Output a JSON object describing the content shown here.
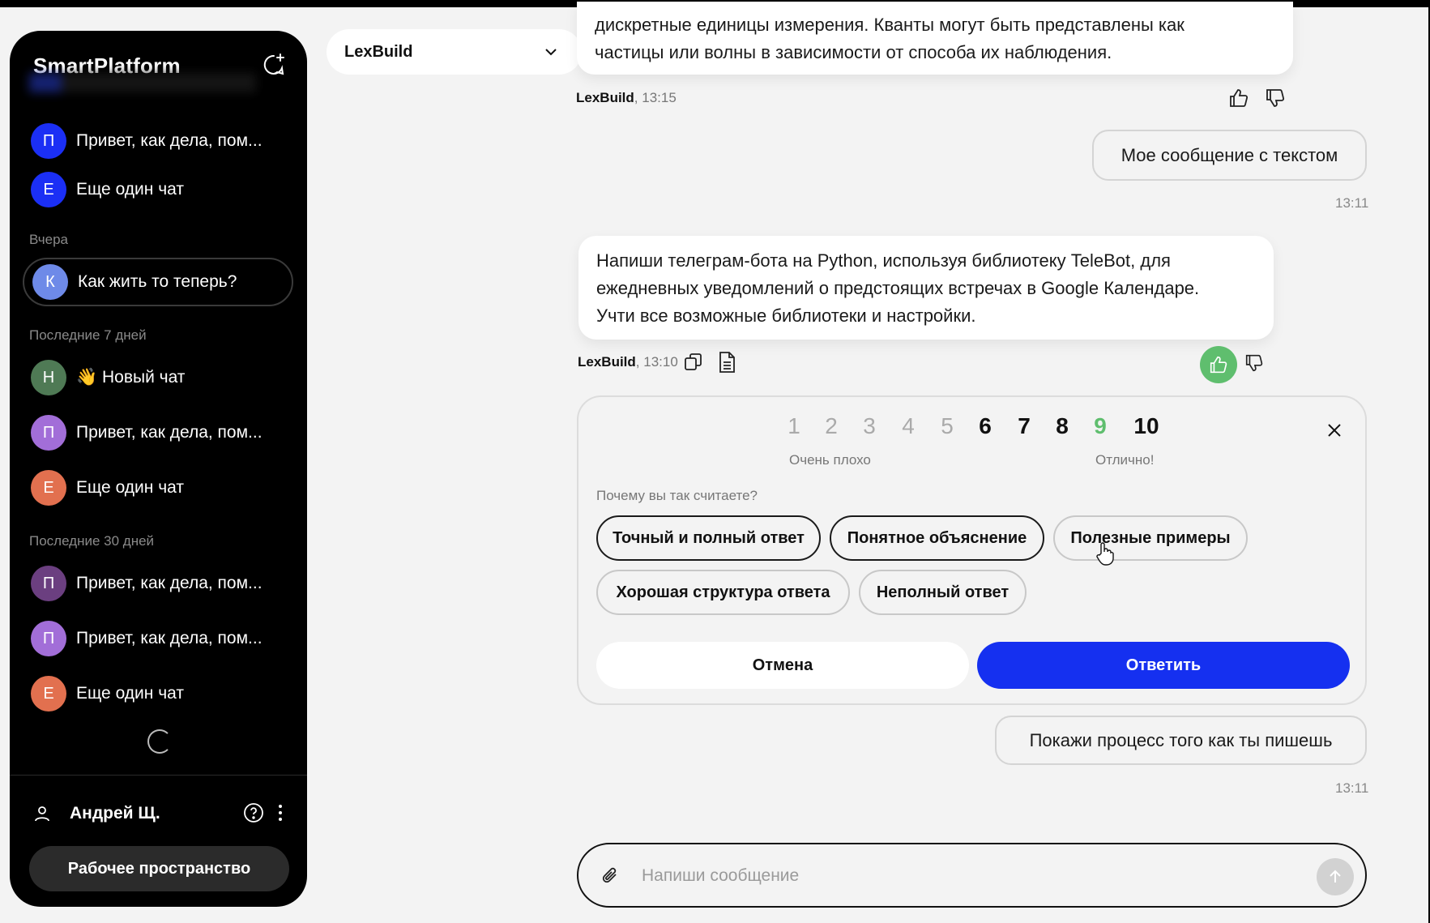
{
  "sidebar": {
    "app_title": "SmartPlatform",
    "chats_top": [
      {
        "initial": "П",
        "label": "Привет, как дела, пом...",
        "color": "#1b2ff5"
      },
      {
        "initial": "Е",
        "label": "Еще один чат",
        "color": "#1b2ff5"
      }
    ],
    "section_yesterday": "Вчера",
    "chats_yesterday": [
      {
        "initial": "К",
        "label": "Как жить то теперь?",
        "color": "#6e8ae8"
      }
    ],
    "section_week": "Последние 7 дней",
    "chats_week": [
      {
        "initial": "Н",
        "label": "👋 Новый чат",
        "color": "#4f7a55"
      },
      {
        "initial": "П",
        "label": "Привет, как дела, пом...",
        "color": "#a26ed8"
      },
      {
        "initial": "Е",
        "label": "Еще один чат",
        "color": "#e2704f"
      }
    ],
    "section_month": "Последние 30 дней",
    "chats_month": [
      {
        "initial": "П",
        "label": "Привет, как дела, пом...",
        "color": "#6b3f80"
      },
      {
        "initial": "П",
        "label": "Привет, как дела, пом...",
        "color": "#a26ed8"
      },
      {
        "initial": "Е",
        "label": "Еще один чат",
        "color": "#e2704f"
      }
    ],
    "user_name": "Андрей Щ.",
    "workspace_button": "Рабочее пространство"
  },
  "model_selector": {
    "value": "LexBuild"
  },
  "messages": {
    "bot1_text_line1": "дискретные единицы измерения. Кванты могут быть представлены как",
    "bot1_text_line2": "частицы или волны в зависимости от способа их наблюдения.",
    "bot1_author": "LexBuild",
    "bot1_time": ", 13:15",
    "user1_text": "Мое сообщение с текстом",
    "user1_time": "13:11",
    "bot2_line1": "Напиши телеграм-бота на Python, используя библиотеку TeleBot, для",
    "bot2_line2": "ежедневных уведомлений о предстоящих встречах в Google Календаре.",
    "bot2_line3": "Учти все возможные библиотеки и настройки.",
    "bot2_author": "LexBuild",
    "bot2_time": ", 13:10",
    "user2_text": "Покажи процесс того как ты пишешь",
    "user2_time": "13:11"
  },
  "rating": {
    "numbers": [
      "1",
      "2",
      "3",
      "4",
      "5",
      "6",
      "7",
      "8",
      "9",
      "10"
    ],
    "selected": "9",
    "caption_bad": "Очень плохо",
    "caption_good": "Отлично!",
    "why_label": "Почему вы так считаете?",
    "chips": [
      "Точный и полный ответ",
      "Понятное объяснение",
      "Полезные примеры",
      "Хорошая структура ответа",
      "Неполный ответ"
    ],
    "cancel": "Отмена",
    "submit": "Ответить"
  },
  "composer": {
    "placeholder": "Напиши сообщение"
  },
  "colors": {
    "accent": "#1530f0",
    "like": "#5fbe6e"
  }
}
